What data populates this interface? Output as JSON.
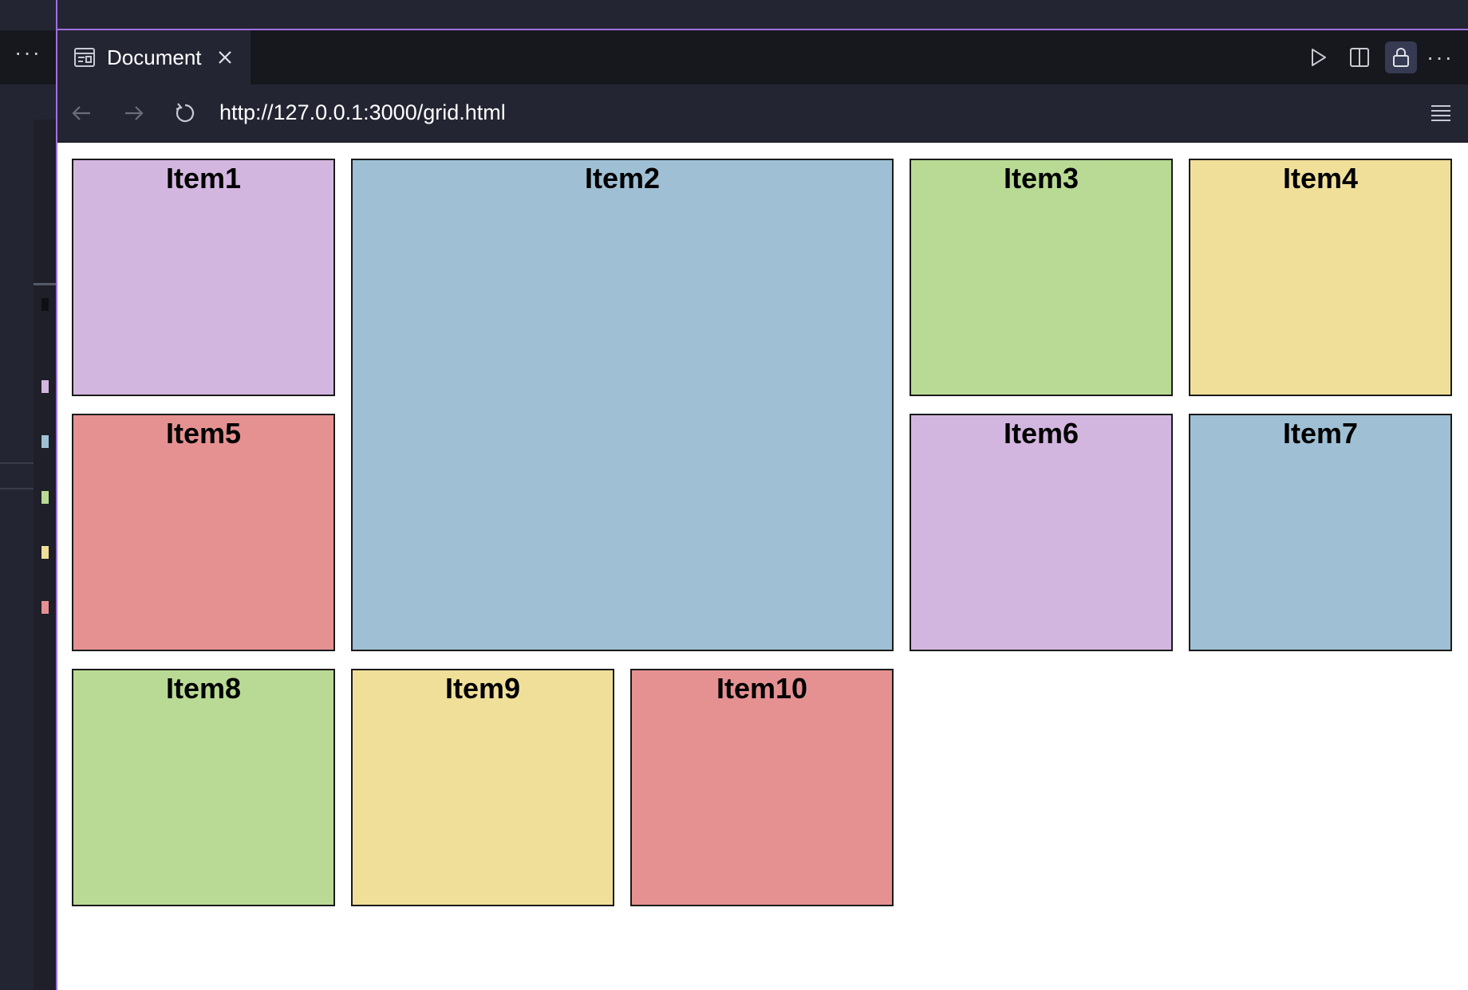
{
  "tab": {
    "title": "Document"
  },
  "address": {
    "url": "http://127.0.0.1:3000/grid.html"
  },
  "left_panel": {
    "more": "···"
  },
  "colors": {
    "purple": "#d3b6df",
    "blue": "#9fc0d4",
    "green": "#b9da94",
    "yellow": "#f0df99",
    "red": "#e59192"
  },
  "grid": {
    "items": [
      {
        "label": "Item1",
        "color": "#d3b6df"
      },
      {
        "label": "Item2",
        "color": "#9fc0d4"
      },
      {
        "label": "Item3",
        "color": "#b9da94"
      },
      {
        "label": "Item4",
        "color": "#f0df99"
      },
      {
        "label": "Item5",
        "color": "#e59192"
      },
      {
        "label": "Item6",
        "color": "#d3b6df"
      },
      {
        "label": "Item7",
        "color": "#9fc0d4"
      },
      {
        "label": "Item8",
        "color": "#b9da94"
      },
      {
        "label": "Item9",
        "color": "#f0df99"
      },
      {
        "label": "Item10",
        "color": "#e59192"
      }
    ]
  }
}
